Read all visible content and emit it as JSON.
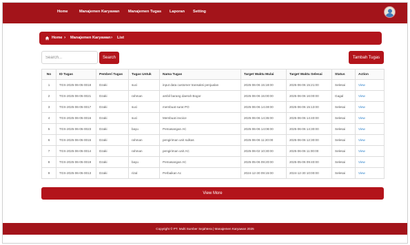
{
  "nav": {
    "items": [
      "Home",
      "Manajemen Karyawan",
      "Manajemen Tugas",
      "Laporan",
      "Setting"
    ]
  },
  "breadcrumb": {
    "home": "Home",
    "section": "Manajemen Karyawan",
    "current": "List"
  },
  "search": {
    "placeholder": "Search...",
    "button": "Search"
  },
  "add_button": "Tambah Tugas",
  "table": {
    "headers": [
      "No",
      "ID Tugas",
      "Pemberi Tugas",
      "Tugas Untuk",
      "Nama Tugas",
      "Target Waktu Mulai",
      "Target Waktu Selesai",
      "Status",
      "Action"
    ],
    "rows": [
      [
        "1",
        "TGS-2025-06-05-0018",
        "Dzaki",
        "suci",
        "input data customer transaksi penjualan",
        "2025-06-06 15:18:00",
        "2025-06-06 15:21:00",
        "Selesai",
        "View"
      ],
      [
        "2",
        "TGS-2025-06-05-0021",
        "Dzaki",
        "rahman",
        "ambil barang daerah Bogor",
        "2025-06-06 15:00:00",
        "2025-06-06 16:00:00",
        "Gagal",
        "View"
      ],
      [
        "3",
        "TGS-2025-06-05-0017",
        "Dzaki",
        "suci",
        "membuat surat PO",
        "2025-06-06 14:49:00",
        "2025-06-06 15:13:00",
        "Selesai",
        "View"
      ],
      [
        "4",
        "TGS-2025-06-05-0016",
        "Dzaki",
        "suci",
        "Membuat invoice",
        "2025-06-06 14:35:00",
        "2025-06-06 14:40:00",
        "Selesai",
        "View"
      ],
      [
        "5",
        "TGS-2025-06-05-0023",
        "Dzaki",
        "bayu",
        "Pemasangan AC",
        "2025-06-06 14:08:00",
        "2025-06-06 14:30:00",
        "Selesai",
        "View"
      ],
      [
        "6",
        "TGS-2025-06-05-0015",
        "Dzaki",
        "rahman",
        "pengiriman unit sulkas",
        "2025-06-06 11:20:00",
        "2025-06-06 12:30:00",
        "Selesai",
        "View"
      ],
      [
        "7",
        "TGS-2025-06-05-0014",
        "Dzaki",
        "rahman",
        "pengiriman unit AC",
        "2025-06-02 10:30:00",
        "2025-06-06 11:00:00",
        "Selesai",
        "View"
      ],
      [
        "8",
        "TGS-2025-06-05-0019",
        "Dzaki",
        "bayu",
        "Pemasangan AC",
        "2025-05-06 09:20:00",
        "2025-05-06 09:40:00",
        "Selesai",
        "View"
      ],
      [
        "9",
        "TGS-2025-06-05-0013",
        "Dzaki",
        "rizal",
        "Perbaikan Ac",
        "2024-12-30 09:15:00",
        "2024-12-30 10:00:00",
        "Selesai",
        "View"
      ]
    ]
  },
  "view_more": "View More",
  "footer": "Copyright © PT. Multi Sumber Sejahtera | Manajemen Karyawan 2025",
  "colors": {
    "brand": "#b3141b",
    "link": "#2a7fc9"
  }
}
